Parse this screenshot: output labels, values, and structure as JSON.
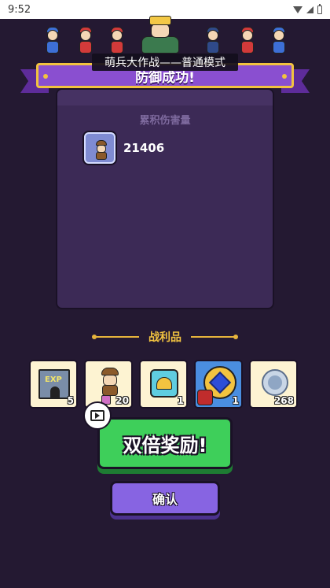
{
  "status_bar": {
    "time": "9:52"
  },
  "mode_label": "萌兵大作战——普通模式",
  "banner": {
    "title": "防御成功!"
  },
  "damage_panel": {
    "title": "累积伤害量",
    "value": "21406"
  },
  "spoils": {
    "title": "战利品",
    "items": [
      {
        "icon": "exp-castle-icon",
        "label": "EXP",
        "count": "5"
      },
      {
        "icon": "miner-unit-icon",
        "count": "20"
      },
      {
        "icon": "gold-helmet-icon",
        "count": "1"
      },
      {
        "icon": "blue-gem-ring-icon",
        "count": "1"
      },
      {
        "icon": "silver-coin-icon",
        "count": "268"
      }
    ]
  },
  "buttons": {
    "double_reward": "双倍奖励!",
    "confirm": "确认"
  },
  "colors": {
    "background": "#241932",
    "panel": "#3c2a56",
    "banner": "#8a4fd0",
    "gold": "#f2c340",
    "green_button": "#3ecf5a",
    "purple_button": "#8764e2"
  }
}
